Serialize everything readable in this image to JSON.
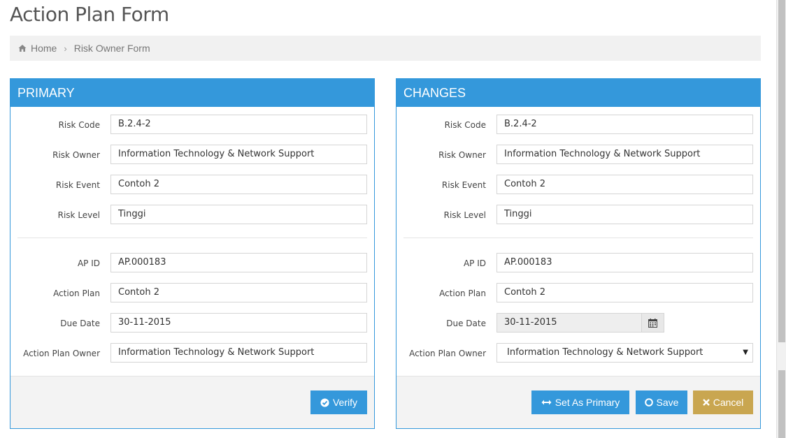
{
  "page": {
    "title": "Action Plan Form"
  },
  "breadcrumb": {
    "home": "Home",
    "current": "Risk Owner Form"
  },
  "primary": {
    "heading": "PRIMARY",
    "fields": {
      "risk_code": {
        "label": "Risk Code",
        "value": "B.2.4-2"
      },
      "risk_owner": {
        "label": "Risk Owner",
        "value": "Information Technology & Network Support"
      },
      "risk_event": {
        "label": "Risk Event",
        "value": "Contoh 2"
      },
      "risk_level": {
        "label": "Risk Level",
        "value": "Tinggi"
      },
      "ap_id": {
        "label": "AP ID",
        "value": "AP.000183"
      },
      "action_plan": {
        "label": "Action Plan",
        "value": "Contoh 2"
      },
      "due_date": {
        "label": "Due Date",
        "value": "30-11-2015"
      },
      "ap_owner": {
        "label": "Action Plan Owner",
        "value": "Information Technology & Network Support"
      }
    },
    "buttons": {
      "verify": "Verify"
    }
  },
  "changes": {
    "heading": "CHANGES",
    "fields": {
      "risk_code": {
        "label": "Risk Code",
        "value": "B.2.4-2"
      },
      "risk_owner": {
        "label": "Risk Owner",
        "value": "Information Technology & Network Support"
      },
      "risk_event": {
        "label": "Risk Event",
        "value": "Contoh 2"
      },
      "risk_level": {
        "label": "Risk Level",
        "value": "Tinggi"
      },
      "ap_id": {
        "label": "AP ID",
        "value": "AP.000183"
      },
      "action_plan": {
        "label": "Action Plan",
        "value": "Contoh 2"
      },
      "due_date": {
        "label": "Due Date",
        "value": "30-11-2015"
      },
      "ap_owner": {
        "label": "Action Plan Owner",
        "value": "Information Technology & Network Support"
      }
    },
    "buttons": {
      "set_primary": "Set As Primary",
      "save": "Save",
      "cancel": "Cancel"
    }
  },
  "colors": {
    "primary": "#3498db",
    "cancel": "#c9a650"
  }
}
